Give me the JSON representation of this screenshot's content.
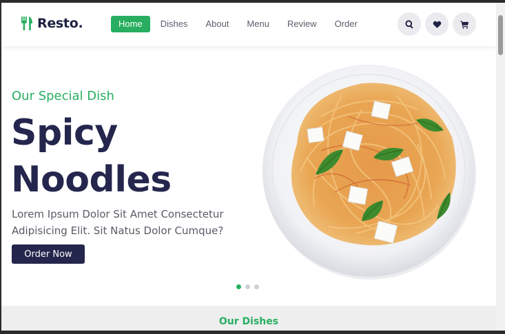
{
  "brand": {
    "name": "Resto."
  },
  "nav": {
    "items": [
      {
        "label": "Home",
        "active": true
      },
      {
        "label": "Dishes",
        "active": false
      },
      {
        "label": "About",
        "active": false
      },
      {
        "label": "Menu",
        "active": false
      },
      {
        "label": "Review",
        "active": false
      },
      {
        "label": "Order",
        "active": false
      }
    ]
  },
  "header_icons": [
    "search-icon",
    "heart-icon",
    "cart-icon"
  ],
  "hero": {
    "subtitle": "Our Special Dish",
    "title_line1": "Spicy",
    "title_line2": "Noodles",
    "description": "Lorem Ipsum Dolor Sit Amet Consectetur Adipisicing Elit. Sit Natus Dolor Cumque?",
    "button_label": "Order Now",
    "slides": {
      "count": 3,
      "active": 1
    }
  },
  "section": {
    "title": "Our Dishes"
  },
  "colors": {
    "accent": "#27ae60",
    "brand_dark": "#25264d",
    "icon_bg": "#ebebef"
  }
}
